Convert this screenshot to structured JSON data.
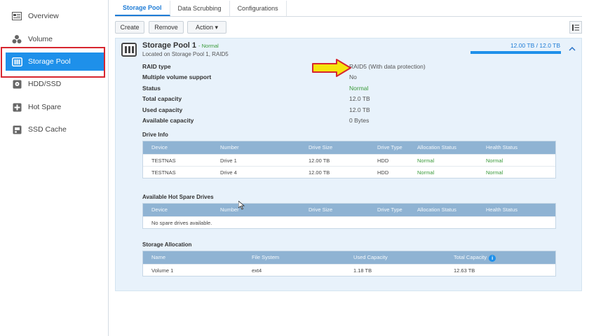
{
  "sidebar": {
    "items": [
      {
        "label": "Overview",
        "icon": "overview-icon"
      },
      {
        "label": "Volume",
        "icon": "volume-icon"
      },
      {
        "label": "Storage Pool",
        "icon": "storage-pool-icon"
      },
      {
        "label": "HDD/SSD",
        "icon": "hdd-icon"
      },
      {
        "label": "Hot Spare",
        "icon": "hot-spare-icon"
      },
      {
        "label": "SSD Cache",
        "icon": "ssd-cache-icon"
      }
    ],
    "active_item": "Storage Pool",
    "active_color": "#1e90ea",
    "highlight_color": "#d7262f"
  },
  "tabs": [
    "Storage Pool",
    "Data Scrubbing",
    "Configurations"
  ],
  "toolbar": {
    "create": "Create",
    "remove": "Remove",
    "action": "Action ▾"
  },
  "pool": {
    "title": "Storage Pool 1",
    "status": "- Normal",
    "location": "Located on Storage Pool 1, RAID5",
    "capacity_text": "12.00 TB / 12.0  TB",
    "capacity_fraction": 1.0,
    "details": [
      {
        "key": "RAID type",
        "value": "RAID5  (With data protection)"
      },
      {
        "key": "Multiple volume support",
        "value": "No"
      },
      {
        "key": "Status",
        "value": "Normal"
      },
      {
        "key": "Total capacity",
        "value": "12.0  TB"
      },
      {
        "key": "Used capacity",
        "value": "12.0  TB"
      },
      {
        "key": "Available capacity",
        "value": "0 Bytes"
      }
    ]
  },
  "drive_info": {
    "label": "Drive Info",
    "columns": [
      "Device",
      "Number",
      "Drive Size",
      "Drive Type",
      "Allocation Status",
      "Health Status"
    ],
    "rows": [
      [
        "TESTNAS",
        "Drive 1",
        "12.00 TB",
        "HDD",
        "Normal",
        "Normal"
      ],
      [
        "TESTNAS",
        "Drive 4",
        "12.00 TB",
        "HDD",
        "Normal",
        "Normal"
      ]
    ]
  },
  "hot_spare": {
    "label": "Available Hot Spare Drives",
    "columns": [
      "Device",
      "Number",
      "Drive Size",
      "Drive Type",
      "Allocation Status",
      "Health Status"
    ],
    "empty_text": "No spare drives available."
  },
  "allocation": {
    "label": "Storage Allocation",
    "columns": [
      "Name",
      "File System",
      "Used Capacity",
      "Total Capacity"
    ],
    "rows": [
      [
        "Volume 1",
        "ext4",
        "1.18 TB",
        "12.63 TB"
      ]
    ]
  },
  "annotation": {
    "arrow_color": "#f5e50c",
    "arrow_outline": "#d7262f"
  }
}
